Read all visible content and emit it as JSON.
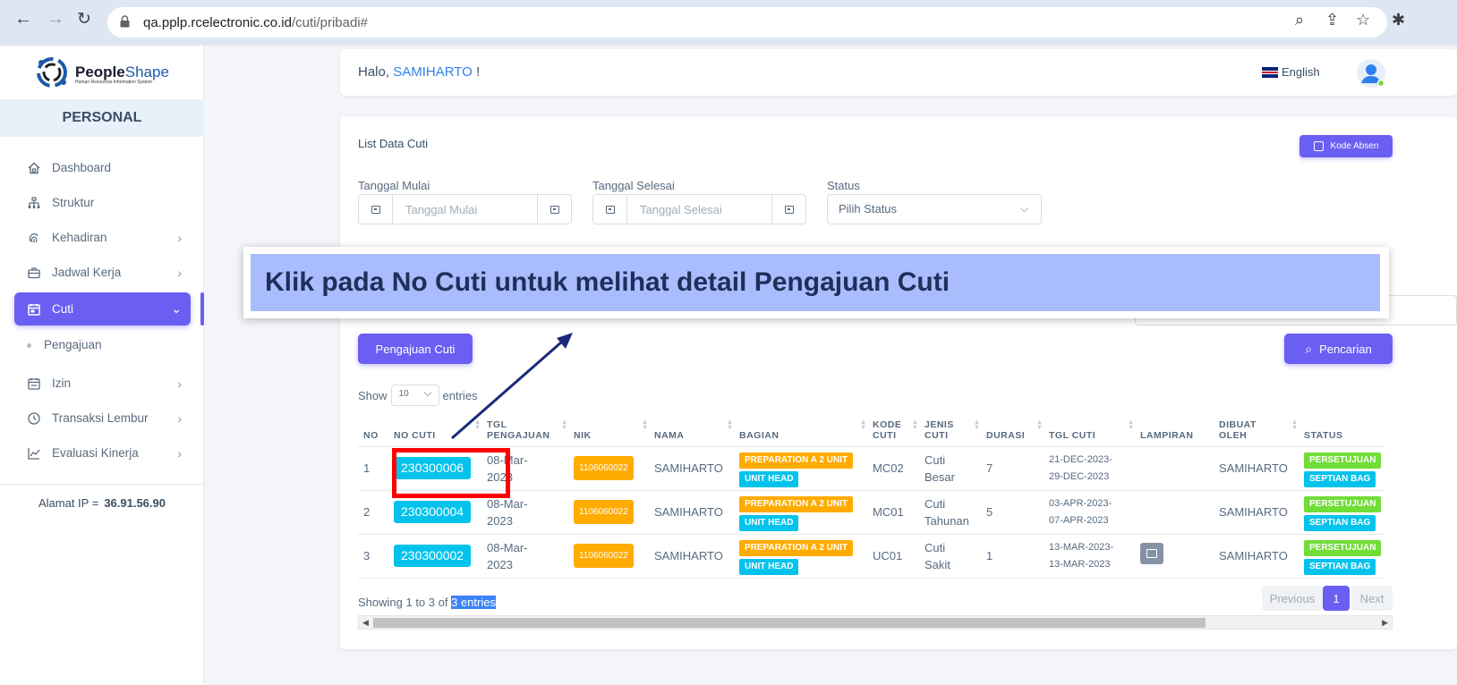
{
  "browser": {
    "url_host": "qa.pplp.rcelectronic.co.id",
    "url_path": "/cuti/pribadi#"
  },
  "sidebar": {
    "logo_name_bold": "People",
    "logo_name_rest": "Shape",
    "logo_tagline": "Human Resources Information System",
    "section": "PERSONAL",
    "items": [
      {
        "label": "Dashboard"
      },
      {
        "label": "Struktur"
      },
      {
        "label": "Kehadiran"
      },
      {
        "label": "Jadwal Kerja"
      },
      {
        "label": "Cuti"
      },
      {
        "label": "Izin"
      },
      {
        "label": "Transaksi Lembur"
      },
      {
        "label": "Evaluasi Kinerja"
      }
    ],
    "sub_item": "Pengajuan",
    "ip_label": "Alamat IP  =",
    "ip_value": "36.91.56.90"
  },
  "topbar": {
    "greeting": "Halo, ",
    "user": "SAMIHARTO",
    "exclaim": " !",
    "language": "English"
  },
  "card": {
    "title": "List Data Cuti",
    "kode_absen": "Kode Absen",
    "filters": {
      "start_label": "Tanggal Mulai",
      "start_placeholder": "Tanggal Mulai",
      "end_label": "Tanggal Selesai",
      "end_placeholder": "Tanggal Selesai",
      "status_label": "Status",
      "status_value": "Pilih Status"
    },
    "pengajuan_btn": "Pengajuan Cuti",
    "pencarian_btn": "Pencarian",
    "show": "Show",
    "entries_value": "10",
    "entries": "entries"
  },
  "table": {
    "headers": {
      "no": "NO",
      "no_cuti": "NO CUTI",
      "tgl_pengajuan_1": "TGL",
      "tgl_pengajuan_2": "PENGAJUAN",
      "nik": "NIK",
      "nama": "NAMA",
      "bagian": "BAGIAN",
      "kode_1": "KODE",
      "kode_2": "CUTI",
      "jenis_1": "JENIS",
      "jenis_2": "CUTI",
      "durasi": "DURASI",
      "tgl_cuti": "TGL CUTI",
      "lampiran": "LAMPIRAN",
      "dibuat_1": "DIBUAT",
      "dibuat_2": "OLEH",
      "status": "STATUS"
    },
    "rows": [
      {
        "no": "1",
        "no_cuti": "230300006",
        "tgl_1": "08-Mar-",
        "tgl_2": "2023",
        "nik": "1106060022",
        "nama": "SAMIHARTO",
        "bagian_1": "PREPARATION A 2 UNIT",
        "bagian_2": "UNIT HEAD",
        "kode": "MC02",
        "jenis_1": "Cuti",
        "jenis_2": "Besar",
        "durasi": "7",
        "cuti_1": "21-DEC-2023-",
        "cuti_2": "29-DEC-2023",
        "dibuat": "SAMIHARTO",
        "status_1": "PERSETUJUAN",
        "status_2": "SEPTIAN BAG"
      },
      {
        "no": "2",
        "no_cuti": "230300004",
        "tgl_1": "08-Mar-",
        "tgl_2": "2023",
        "nik": "1106060022",
        "nama": "SAMIHARTO",
        "bagian_1": "PREPARATION A 2 UNIT",
        "bagian_2": "UNIT HEAD",
        "kode": "MC01",
        "jenis_1": "Cuti",
        "jenis_2": "Tahunan",
        "durasi": "5",
        "cuti_1": "03-APR-2023-",
        "cuti_2": "07-APR-2023",
        "dibuat": "SAMIHARTO",
        "status_1": "PERSETUJUAN",
        "status_2": "SEPTIAN BAG"
      },
      {
        "no": "3",
        "no_cuti": "230300002",
        "tgl_1": "08-Mar-",
        "tgl_2": "2023",
        "nik": "1106060022",
        "nama": "SAMIHARTO",
        "bagian_1": "PREPARATION A 2 UNIT",
        "bagian_2": "UNIT HEAD",
        "kode": "UC01",
        "jenis_1": "Cuti",
        "jenis_2": "Sakit",
        "durasi": "1",
        "cuti_1": "13-MAR-2023-",
        "cuti_2": "13-MAR-2023",
        "dibuat": "SAMIHARTO",
        "status_1": "PERSETUJUAN",
        "status_2": "SEPTIAN BAG"
      }
    ]
  },
  "footer": {
    "showing": "Showing 1 to 3 of ",
    "showing_hl": "3 entries",
    "previous": "Previous",
    "page": "1",
    "next": "Next"
  },
  "annotation": {
    "text": "Klik pada No Cuti untuk melihat detail Pengajuan Cuti"
  },
  "colors": {
    "primary": "#6a5ff2",
    "cyan_badge": "#03c3ec",
    "orange_badge": "#ffab00",
    "green_badge": "#71dd37",
    "annotation_bg": "#a9bdfe",
    "highlight_box": "#ff0000"
  }
}
